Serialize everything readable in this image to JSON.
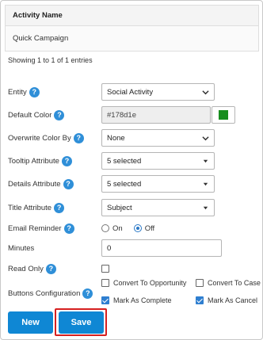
{
  "table": {
    "header": "Activity Name",
    "rows": [
      "Quick Campaign"
    ],
    "entries_text": "Showing 1 to 1 of 1 entries"
  },
  "form": {
    "entity": {
      "label": "Entity",
      "value": "Social Activity"
    },
    "default_color": {
      "label": "Default Color",
      "value": "#178d1e",
      "swatch_color": "#178d1e"
    },
    "overwrite_color_by": {
      "label": "Overwrite Color By",
      "value": "None"
    },
    "tooltip_attribute": {
      "label": "Tooltip Attribute",
      "value": "5 selected"
    },
    "details_attribute": {
      "label": "Details Attribute",
      "value": "5 selected"
    },
    "title_attribute": {
      "label": "Title Attribute",
      "value": "Subject"
    },
    "email_reminder": {
      "label": "Email Reminder",
      "on_label": "On",
      "off_label": "Off",
      "selected": "Off"
    },
    "minutes": {
      "label": "Minutes",
      "value": "0"
    },
    "read_only": {
      "label": "Read Only",
      "checked": false
    },
    "buttons_configuration": {
      "label": "Buttons Configuration",
      "options": [
        {
          "label": "Convert To Opportunity",
          "checked": false
        },
        {
          "label": "Convert To Case",
          "checked": false
        },
        {
          "label": "Mark As Complete",
          "checked": true
        },
        {
          "label": "Mark As Cancel",
          "checked": true
        }
      ]
    }
  },
  "buttons": {
    "new": "New",
    "save": "Save"
  },
  "help_glyph": "?",
  "colors": {
    "accent": "#0f87d4",
    "help": "#2f8fd8",
    "highlight": "#d62020"
  }
}
